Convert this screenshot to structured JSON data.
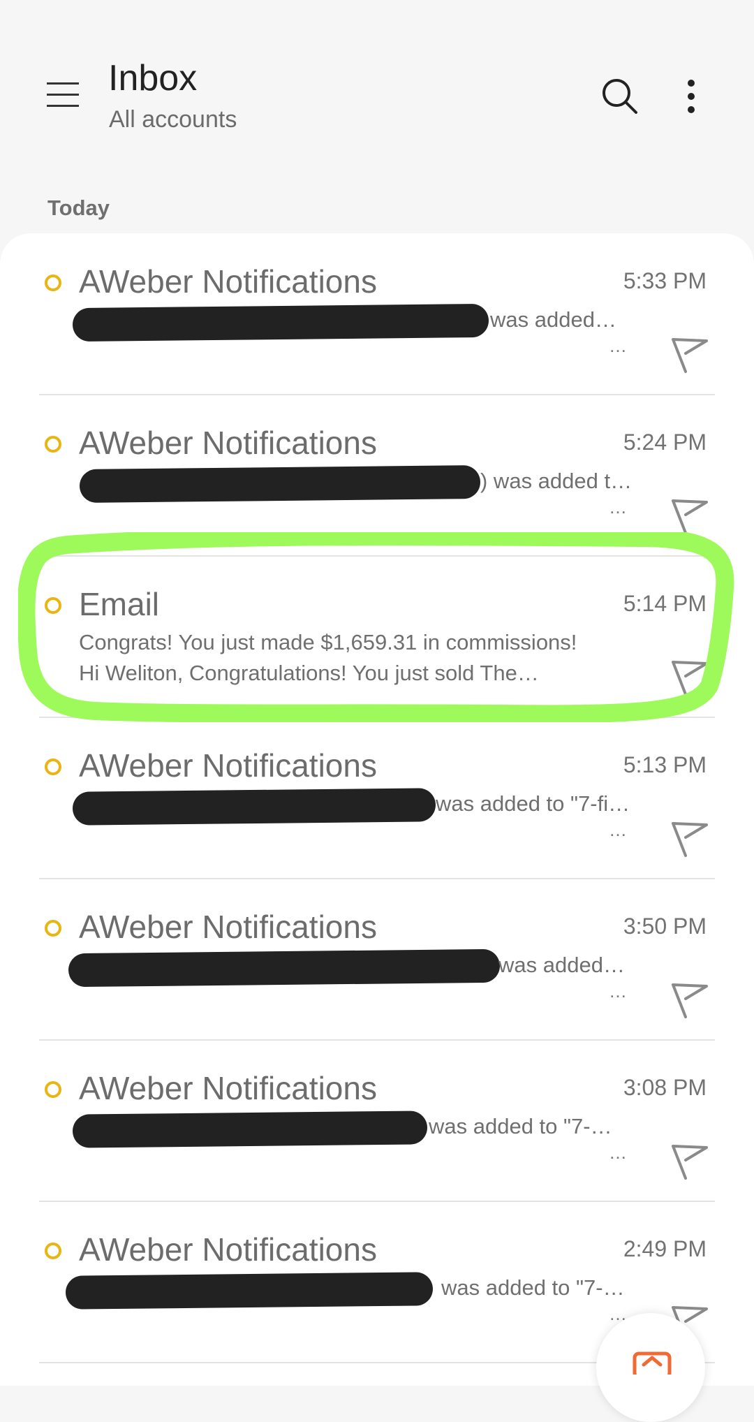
{
  "header": {
    "title": "Inbox",
    "subtitle": "All accounts",
    "menu_icon": "hamburger-menu-icon",
    "search_icon": "search-icon",
    "more_icon": "more-vertical-icon"
  },
  "section": {
    "label": "Today"
  },
  "colors": {
    "unread_dot": "#e8b512",
    "highlight": "#9dfa5a",
    "compose_accent": "#ef6a34"
  },
  "messages": [
    {
      "sender": "AWeber Notifications",
      "time": "5:33 PM",
      "preview_visible": "was added…",
      "snippet": "…",
      "redacted": true
    },
    {
      "sender": "AWeber Notifications",
      "time": "5:24 PM",
      "preview_visible": ") was added t…",
      "snippet": "…",
      "redacted": true
    },
    {
      "sender": "Email",
      "time": "5:14 PM",
      "subject": "Congrats! You just made $1,659.31 in commissions!",
      "snippet": "Hi Weliton,   Congratulations! You just sold The…",
      "redacted": false
    },
    {
      "sender": "AWeber Notifications",
      "time": "5:13 PM",
      "preview_visible": "was added to \"7-fi…",
      "snippet": "…",
      "redacted": true
    },
    {
      "sender": "AWeber Notifications",
      "time": "3:50 PM",
      "preview_visible": "was added…",
      "snippet": "…",
      "redacted": true
    },
    {
      "sender": "AWeber Notifications",
      "time": "3:08 PM",
      "preview_visible": "was added to \"7-…",
      "snippet": "…",
      "redacted": true
    },
    {
      "sender": "AWeber Notifications",
      "time": "2:49 PM",
      "preview_visible": "was added to \"7-…",
      "snippet": "…",
      "redacted": true
    }
  ]
}
